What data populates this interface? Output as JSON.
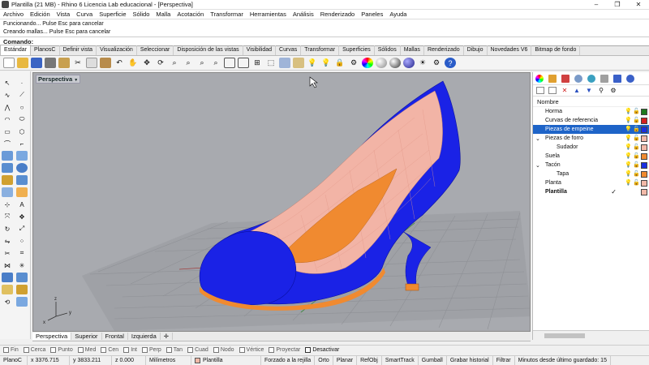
{
  "window": {
    "title": "Plantilla (21 MB) - Rhino 6 Licencia Lab educacional - [Perspectiva]",
    "min": "–",
    "max": "❐",
    "close": "✕"
  },
  "menu": [
    "Archivo",
    "Edición",
    "Vista",
    "Curva",
    "Superficie",
    "Sólido",
    "Malla",
    "Acotación",
    "Transformar",
    "Herramientas",
    "Análisis",
    "Renderizado",
    "Paneles",
    "Ayuda"
  ],
  "command_history": [
    "Funcionando... Pulse Esc para cancelar",
    "Creando mallas... Pulse Esc para cancelar"
  ],
  "command_prompt": "Comando:",
  "toolbar_tabs": [
    "Estándar",
    "PlanosC",
    "Definir vista",
    "Visualización",
    "Seleccionar",
    "Disposición de las vistas",
    "Visibilidad",
    "Curvas",
    "Transformar",
    "Superficies",
    "Sólidos",
    "Mallas",
    "Renderizado",
    "Dibujo",
    "Novedades V6",
    "Bitmap de fondo"
  ],
  "active_toolbar_tab": "Estándar",
  "viewport": {
    "label": "Perspectiva",
    "menu_arrow": "▼",
    "tabs": [
      "Perspectiva",
      "Superior",
      "Frontal",
      "Izquierda"
    ],
    "add_tab": "✛",
    "axis_labels": {
      "x": "x",
      "y": "y",
      "z": "z"
    }
  },
  "layers_panel": {
    "header": "Nombre",
    "layers": [
      {
        "name": "Horma",
        "indent": 0,
        "expander": "",
        "selected": false,
        "color": "#1e7a1e",
        "current": false
      },
      {
        "name": "Curvas de referencia",
        "indent": 0,
        "expander": "",
        "selected": false,
        "color": "#d42020",
        "current": false
      },
      {
        "name": "Piezas de empeine",
        "indent": 0,
        "expander": "",
        "selected": true,
        "color": "#1a2fe0",
        "current": false
      },
      {
        "name": "Piezas de forro",
        "indent": 0,
        "expander": "⌄",
        "selected": false,
        "color": "#f2b9a8",
        "current": false
      },
      {
        "name": "Sudador",
        "indent": 1,
        "expander": "",
        "selected": false,
        "color": "#f2b9a8",
        "current": false
      },
      {
        "name": "Suela",
        "indent": 0,
        "expander": "",
        "selected": false,
        "color": "#f08a30",
        "current": false
      },
      {
        "name": "Tacón",
        "indent": 0,
        "expander": "⌄",
        "selected": false,
        "color": "#1a2fe0",
        "current": false
      },
      {
        "name": "Tapa",
        "indent": 1,
        "expander": "",
        "selected": false,
        "color": "#f08a30",
        "current": false
      },
      {
        "name": "Planta",
        "indent": 0,
        "expander": "",
        "selected": false,
        "color": "#f2b9a8",
        "current": false
      },
      {
        "name": "Plantilla",
        "indent": 0,
        "expander": "",
        "selected": false,
        "color": "#f2b9a8",
        "current": true
      }
    ]
  },
  "osnaps": [
    {
      "label": "Fin",
      "on": false
    },
    {
      "label": "Cerca",
      "on": false
    },
    {
      "label": "Punto",
      "on": false
    },
    {
      "label": "Med",
      "on": false
    },
    {
      "label": "Cen",
      "on": false
    },
    {
      "label": "Int",
      "on": false
    },
    {
      "label": "Perp",
      "on": false
    },
    {
      "label": "Tan",
      "on": false
    },
    {
      "label": "Cuad",
      "on": false
    },
    {
      "label": "Nodo",
      "on": false
    },
    {
      "label": "Vértice",
      "on": false
    },
    {
      "label": "Proyectar",
      "on": false
    },
    {
      "label": "Desactivar",
      "on": true
    }
  ],
  "status": {
    "cplane": "PlanoC",
    "x": "x 3376.715",
    "y": "y 3833.211",
    "z": "z 0.000",
    "units": "Milímetros",
    "layer": "Plantilla",
    "layer_color": "#f2b9a8",
    "buttons": [
      "Forzado a la rejilla",
      "Orto",
      "Planar",
      "RefObj",
      "SmartTrack",
      "Gumball",
      "Grabar historial",
      "Filtrar",
      "Minutos desde último guardado: 15"
    ]
  },
  "colors": {
    "shoe_body": "#1a22e6",
    "lining": "#f2b4a6",
    "sole": "#f08a30",
    "viewport_bg": "#a8aaaf",
    "selection": "#1e64c8"
  }
}
